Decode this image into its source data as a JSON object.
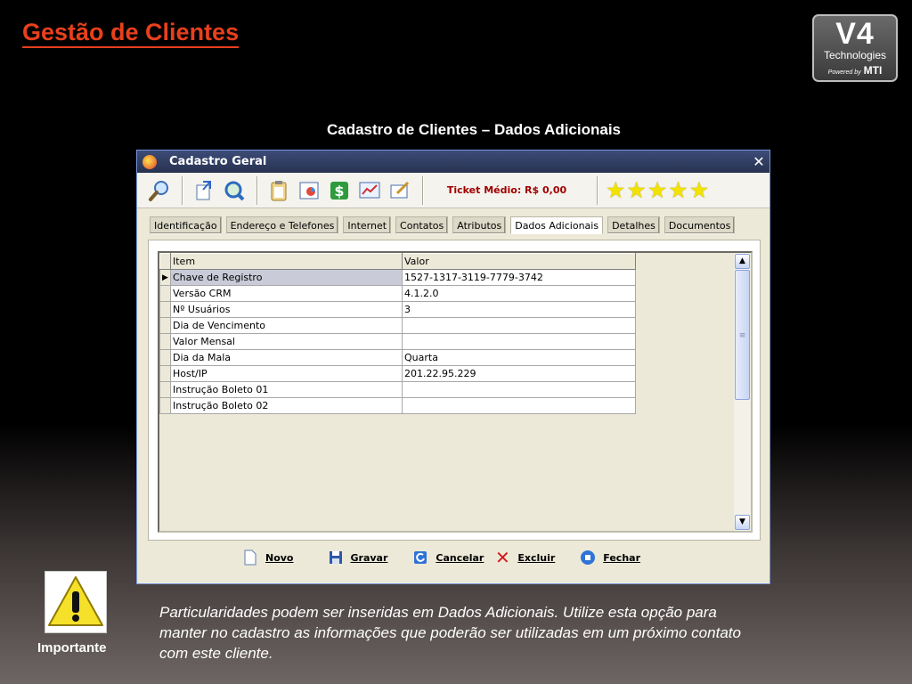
{
  "slide": {
    "title": "Gestão de Clientes",
    "section_title": "Cadastro de Clientes – Dados Adicionais"
  },
  "logo": {
    "brand": "V4",
    "subtitle": "Technologies",
    "powered_by": "Powered by",
    "partner": "MTI"
  },
  "window": {
    "title": "Cadastro Geral",
    "close_glyph": "✕"
  },
  "toolbar": {
    "ticket_label": "Ticket Médio: R$ 0,00",
    "star_rating": 5,
    "icons": [
      "search-icon",
      "export-icon",
      "find-icon",
      "clipboard-icon",
      "chart-window-icon",
      "money-icon",
      "graph-icon",
      "edit-icon"
    ]
  },
  "tabs": [
    {
      "label": "Identificação"
    },
    {
      "label": "Endereço e Telefones"
    },
    {
      "label": "Internet"
    },
    {
      "label": "Contatos"
    },
    {
      "label": "Atributos"
    },
    {
      "label": "Dados Adicionais",
      "active": true
    },
    {
      "label": "Detalhes"
    },
    {
      "label": "Documentos"
    }
  ],
  "grid": {
    "columns": [
      "Item",
      "Valor"
    ],
    "rows": [
      {
        "item": "Chave de Registro",
        "value": "1527-1317-3119-7779-3742",
        "current": true
      },
      {
        "item": "Versão CRM",
        "value": "4.1.2.0"
      },
      {
        "item": "Nº Usuários",
        "value": "3"
      },
      {
        "item": "Dia de Vencimento",
        "value": ""
      },
      {
        "item": "Valor Mensal",
        "value": ""
      },
      {
        "item": "Dia da Mala",
        "value": "Quarta"
      },
      {
        "item": "Host/IP",
        "value": "201.22.95.229"
      },
      {
        "item": "Instrução Boleto 01",
        "value": ""
      },
      {
        "item": "Instrução Boleto 02",
        "value": ""
      }
    ]
  },
  "footer": {
    "novo": "Novo",
    "gravar": "Gravar",
    "cancelar": "Cancelar",
    "excluir": "Excluir",
    "fechar": "Fechar"
  },
  "warning": {
    "label": "Importante"
  },
  "note": "Particularidades podem ser inseridas em Dados Adicionais. Utilize esta opção para manter no cadastro as informações que poderão ser utilizadas em um próximo contato com este cliente.",
  "colors": {
    "title": "#e8401c",
    "ticket": "#a00000",
    "titlebar": "#27324f"
  }
}
